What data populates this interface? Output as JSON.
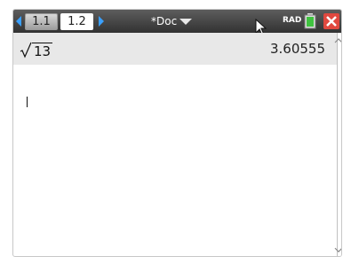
{
  "tabs": [
    {
      "label": "1.1"
    },
    {
      "label": "1.2"
    }
  ],
  "document": {
    "title": "*Doc"
  },
  "status": {
    "angle_mode": "RAD"
  },
  "calculator": {
    "entry": {
      "radicand": "13",
      "result": "3.60555"
    }
  },
  "icons": {
    "prev": "chevron-left-icon",
    "next": "chevron-right-icon",
    "menu": "caret-down-icon",
    "pointer": "mouse-cursor-icon",
    "battery": "battery-icon",
    "close": "close-icon"
  },
  "colors": {
    "titlebar": "#3c3c3c",
    "nav_arrow": "#3aa0ff",
    "entry_background": "#e8e8e8",
    "battery_green": "#3fc23f",
    "close_red": "#e0483f"
  }
}
